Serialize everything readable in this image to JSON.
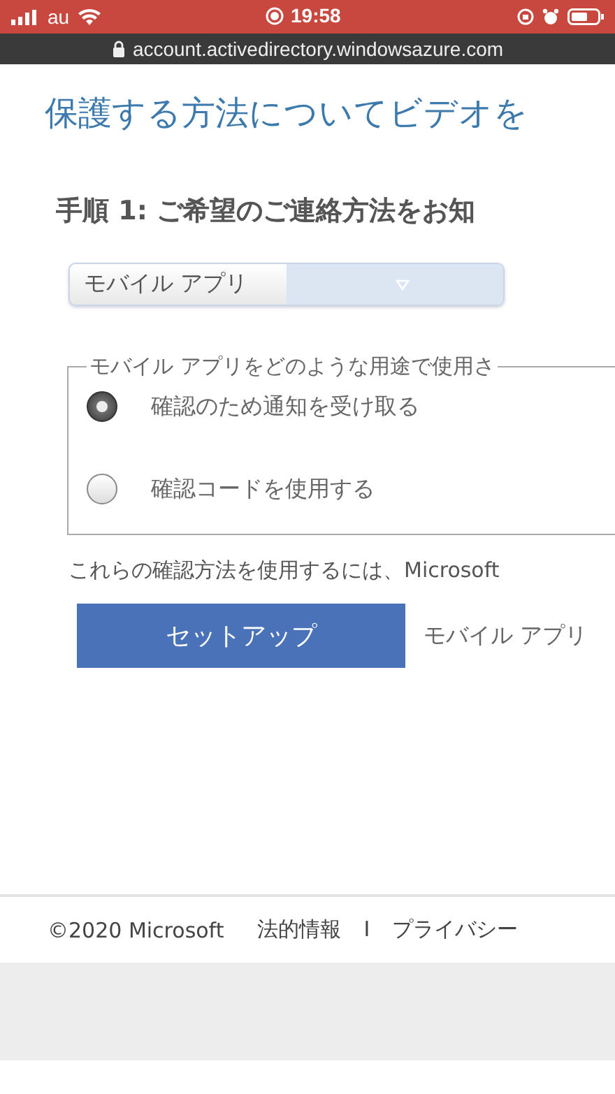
{
  "status_bar": {
    "carrier": "au",
    "time": "19:58"
  },
  "url_bar": {
    "url": "account.activedirectory.windowsazure.com"
  },
  "video_link": "保護する方法についてビデオを",
  "step_heading": "手順 1: ご希望のご連絡方法をお知",
  "contact_method": {
    "value": "モバイル アプリ"
  },
  "usage_group": {
    "legend": "モバイル アプリをどのような用途で使用さ",
    "options": [
      {
        "label": "確認のため通知を受け取る",
        "selected": true
      },
      {
        "label": "確認コードを使用する",
        "selected": false
      }
    ]
  },
  "note": "これらの確認方法を使用するには、Microsoft",
  "setup_button": "セットアップ",
  "setup_hint": "モバイル アプリ",
  "footer": {
    "copyright": "©2020 Microsoft",
    "links": [
      "法的情報",
      "プライバシー"
    ],
    "separator": "I"
  }
}
